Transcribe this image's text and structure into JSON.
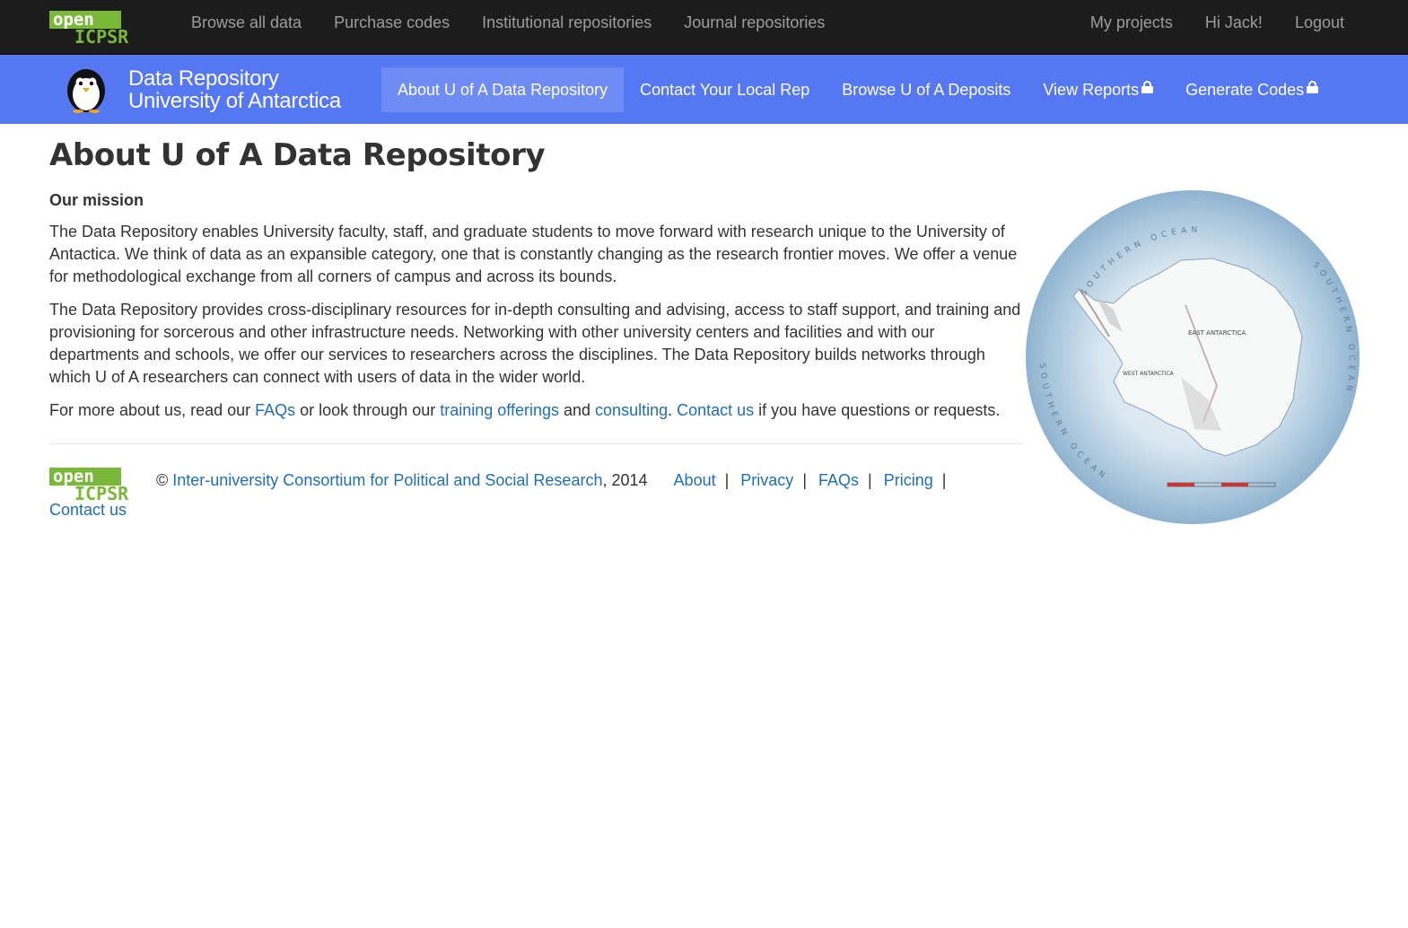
{
  "topbar": {
    "logo_open": "open",
    "logo_icpsr": "ICPSR",
    "left_links": [
      "Browse all data",
      "Purchase codes",
      "Institutional repositories",
      "Journal repositories"
    ],
    "right_links": [
      "My projects",
      "Hi Jack!",
      "Logout"
    ]
  },
  "brandbar": {
    "title_line1": "Data Repository",
    "title_line2": "University of Antarctica",
    "nav": [
      {
        "label": "About U of A Data Repository",
        "active": true,
        "locked": false
      },
      {
        "label": "Contact Your Local Rep",
        "active": false,
        "locked": false
      },
      {
        "label": "Browse U of A Deposits",
        "active": false,
        "locked": false
      },
      {
        "label": "View Reports",
        "active": false,
        "locked": true
      },
      {
        "label": "Generate Codes",
        "active": false,
        "locked": true
      }
    ]
  },
  "content": {
    "heading": "About U of A Data Repository",
    "mission_heading": "Our mission",
    "para1": "The Data Repository enables University faculty, staff, and graduate students to move forward with research unique to the University of Antactica. We think of data as an expansible category, one that is constantly changing as the research frontier moves. We offer a venue for methodological exchange from all corners of campus and across its bounds.",
    "para2": "The Data Repository provides cross-disciplinary resources for in-depth consulting and advising, access to staff support, and training and provisioning for sorcerous and other infrastructure needs. Networking with other university centers and facilities and with our departments and schools, we offer our services to researchers across the disciplines. The Data Repository builds networks through which U of A researchers can connect with users of data in the wider world.",
    "para3": {
      "t1": "For more about us, read our ",
      "link_faqs": "FAQs",
      "t2": " or look through our ",
      "link_training": "training offerings",
      "t3": " and ",
      "link_consulting": "consulting",
      "t4": ". ",
      "link_contact": "Contact us",
      "t5": " if you have questions or requests."
    }
  },
  "footer": {
    "copyright": "© ",
    "org_link": "Inter-university Consortium for Political and Social Research",
    "year": ", 2014",
    "links": [
      "About",
      "Privacy",
      "FAQs",
      "Pricing"
    ],
    "separator": "|",
    "contact": "Contact us"
  },
  "map": {
    "label_ocean_top": "SOUTHERN OCEAN",
    "label_ocean_right": "SOUTHERN OCEAN",
    "label_ocean_left": "SOUTHERN OCEAN",
    "label_east": "EAST ANTARCTICA",
    "label_west": "WEST ANTARCTICA"
  },
  "colors": {
    "topbar": "#1c1c1c",
    "brandbar": "#5577f2",
    "active_tab": "#6f8cf4",
    "link": "#1f6fb2",
    "logo_green": "#7ab83a"
  }
}
